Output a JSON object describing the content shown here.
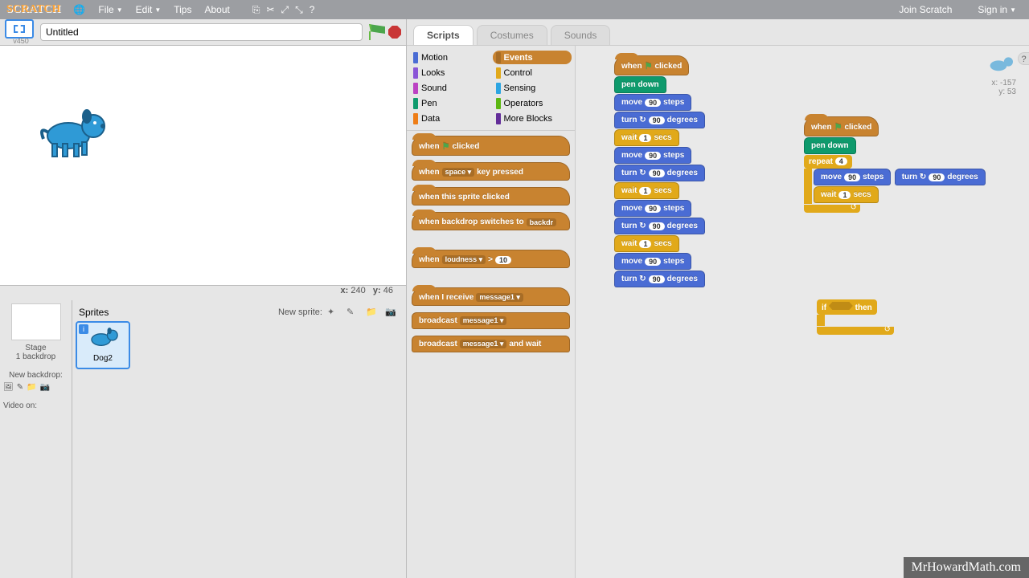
{
  "menubar": {
    "logo": "SCRATCH",
    "file": "File",
    "edit": "Edit",
    "tips": "Tips",
    "about": "About",
    "join": "Join Scratch",
    "signin": "Sign in"
  },
  "project": {
    "title": "Untitled",
    "version": "v450"
  },
  "stage_coords": {
    "label_x": "x:",
    "x": "240",
    "label_y": "y:",
    "y": "46"
  },
  "sprite_panel": {
    "header": "Sprites",
    "new_sprite": "New sprite:",
    "stage_label": "Stage",
    "backdrop_count": "1 backdrop",
    "new_backdrop": "New backdrop:",
    "video_on": "Video on:",
    "sprite_name": "Dog2"
  },
  "tabs": {
    "scripts": "Scripts",
    "costumes": "Costumes",
    "sounds": "Sounds"
  },
  "categories": {
    "motion": {
      "label": "Motion",
      "color": "#4a6cd4"
    },
    "looks": {
      "label": "Looks",
      "color": "#8a55d7"
    },
    "sound": {
      "label": "Sound",
      "color": "#bb42c3"
    },
    "pen": {
      "label": "Pen",
      "color": "#0e9a6c"
    },
    "data": {
      "label": "Data",
      "color": "#ee7d16"
    },
    "events": {
      "label": "Events",
      "color": "#c88330"
    },
    "control": {
      "label": "Control",
      "color": "#e1a91a"
    },
    "sensing": {
      "label": "Sensing",
      "color": "#2ca5e2"
    },
    "operators": {
      "label": "Operators",
      "color": "#5cb712"
    },
    "more": {
      "label": "More Blocks",
      "color": "#632d99"
    }
  },
  "palette_blocks": {
    "when_flag": {
      "pre": "when",
      "post": "clicked"
    },
    "when_key": {
      "pre": "when",
      "key": "space",
      "post": "key pressed"
    },
    "when_sprite": "when this sprite clicked",
    "when_backdrop": {
      "pre": "when backdrop switches to",
      "val": "backdr"
    },
    "when_loudness": {
      "pre": "when",
      "sensor": "loudness",
      "op": ">",
      "val": "10"
    },
    "when_receive": {
      "pre": "when I receive",
      "msg": "message1"
    },
    "broadcast": {
      "pre": "broadcast",
      "msg": "message1"
    },
    "broadcast_wait": {
      "pre": "broadcast",
      "msg": "message1",
      "post": "and wait"
    }
  },
  "script1": {
    "when_flag": {
      "pre": "when",
      "post": "clicked"
    },
    "pen_down": "pen down",
    "move": {
      "pre": "move",
      "val": "90",
      "post": "steps"
    },
    "turn": {
      "pre": "turn ↻",
      "val": "90",
      "post": "degrees"
    },
    "wait": {
      "pre": "wait",
      "val": "1",
      "post": "secs"
    }
  },
  "script2": {
    "when_flag": {
      "pre": "when",
      "post": "clicked"
    },
    "pen_down": "pen down",
    "repeat": {
      "pre": "repeat",
      "val": "4"
    },
    "move": {
      "pre": "move",
      "val": "90",
      "post": "steps"
    },
    "turn": {
      "pre": "turn ↻",
      "val": "90",
      "post": "degrees"
    },
    "wait": {
      "pre": "wait",
      "val": "1",
      "post": "secs"
    }
  },
  "script3": {
    "if": {
      "pre": "if",
      "post": "then"
    }
  },
  "sprite_corner": {
    "x_label": "x:",
    "x": "-157",
    "y_label": "y:",
    "y": "53"
  },
  "watermark": "MrHowardMath.com"
}
